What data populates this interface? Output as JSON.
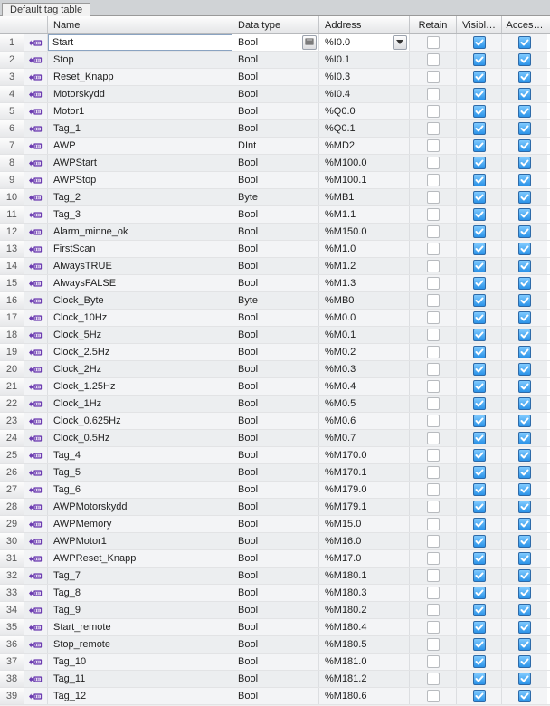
{
  "tab_title": "Default tag table",
  "columns": {
    "name": "Name",
    "dtype": "Data type",
    "addr": "Address",
    "retain": "Retain",
    "visibl": "Visibl…",
    "access": "Acces…"
  },
  "selected_row_index": 0,
  "rows": [
    {
      "num": "1",
      "name": "Start",
      "dtype": "Bool",
      "addr": "%I0.0",
      "retain": false,
      "visibl": true,
      "access": true
    },
    {
      "num": "2",
      "name": "Stop",
      "dtype": "Bool",
      "addr": "%I0.1",
      "retain": false,
      "visibl": true,
      "access": true
    },
    {
      "num": "3",
      "name": "Reset_Knapp",
      "dtype": "Bool",
      "addr": "%I0.3",
      "retain": false,
      "visibl": true,
      "access": true
    },
    {
      "num": "4",
      "name": "Motorskydd",
      "dtype": "Bool",
      "addr": "%I0.4",
      "retain": false,
      "visibl": true,
      "access": true
    },
    {
      "num": "5",
      "name": "Motor1",
      "dtype": "Bool",
      "addr": "%Q0.0",
      "retain": false,
      "visibl": true,
      "access": true
    },
    {
      "num": "6",
      "name": "Tag_1",
      "dtype": "Bool",
      "addr": "%Q0.1",
      "retain": false,
      "visibl": true,
      "access": true
    },
    {
      "num": "7",
      "name": "AWP",
      "dtype": "DInt",
      "addr": "%MD2",
      "retain": false,
      "visibl": true,
      "access": true
    },
    {
      "num": "8",
      "name": "AWPStart",
      "dtype": "Bool",
      "addr": "%M100.0",
      "retain": false,
      "visibl": true,
      "access": true
    },
    {
      "num": "9",
      "name": "AWPStop",
      "dtype": "Bool",
      "addr": "%M100.1",
      "retain": false,
      "visibl": true,
      "access": true
    },
    {
      "num": "10",
      "name": "Tag_2",
      "dtype": "Byte",
      "addr": "%MB1",
      "retain": false,
      "visibl": true,
      "access": true
    },
    {
      "num": "11",
      "name": "Tag_3",
      "dtype": "Bool",
      "addr": "%M1.1",
      "retain": false,
      "visibl": true,
      "access": true
    },
    {
      "num": "12",
      "name": "Alarm_minne_ok",
      "dtype": "Bool",
      "addr": "%M150.0",
      "retain": false,
      "visibl": true,
      "access": true
    },
    {
      "num": "13",
      "name": "FirstScan",
      "dtype": "Bool",
      "addr": "%M1.0",
      "retain": false,
      "visibl": true,
      "access": true
    },
    {
      "num": "14",
      "name": "AlwaysTRUE",
      "dtype": "Bool",
      "addr": "%M1.2",
      "retain": false,
      "visibl": true,
      "access": true
    },
    {
      "num": "15",
      "name": "AlwaysFALSE",
      "dtype": "Bool",
      "addr": "%M1.3",
      "retain": false,
      "visibl": true,
      "access": true
    },
    {
      "num": "16",
      "name": "Clock_Byte",
      "dtype": "Byte",
      "addr": "%MB0",
      "retain": false,
      "visibl": true,
      "access": true
    },
    {
      "num": "17",
      "name": "Clock_10Hz",
      "dtype": "Bool",
      "addr": "%M0.0",
      "retain": false,
      "visibl": true,
      "access": true
    },
    {
      "num": "18",
      "name": "Clock_5Hz",
      "dtype": "Bool",
      "addr": "%M0.1",
      "retain": false,
      "visibl": true,
      "access": true
    },
    {
      "num": "19",
      "name": "Clock_2.5Hz",
      "dtype": "Bool",
      "addr": "%M0.2",
      "retain": false,
      "visibl": true,
      "access": true
    },
    {
      "num": "20",
      "name": "Clock_2Hz",
      "dtype": "Bool",
      "addr": "%M0.3",
      "retain": false,
      "visibl": true,
      "access": true
    },
    {
      "num": "21",
      "name": "Clock_1.25Hz",
      "dtype": "Bool",
      "addr": "%M0.4",
      "retain": false,
      "visibl": true,
      "access": true
    },
    {
      "num": "22",
      "name": "Clock_1Hz",
      "dtype": "Bool",
      "addr": "%M0.5",
      "retain": false,
      "visibl": true,
      "access": true
    },
    {
      "num": "23",
      "name": "Clock_0.625Hz",
      "dtype": "Bool",
      "addr": "%M0.6",
      "retain": false,
      "visibl": true,
      "access": true
    },
    {
      "num": "24",
      "name": "Clock_0.5Hz",
      "dtype": "Bool",
      "addr": "%M0.7",
      "retain": false,
      "visibl": true,
      "access": true
    },
    {
      "num": "25",
      "name": "Tag_4",
      "dtype": "Bool",
      "addr": "%M170.0",
      "retain": false,
      "visibl": true,
      "access": true
    },
    {
      "num": "26",
      "name": "Tag_5",
      "dtype": "Bool",
      "addr": "%M170.1",
      "retain": false,
      "visibl": true,
      "access": true
    },
    {
      "num": "27",
      "name": "Tag_6",
      "dtype": "Bool",
      "addr": "%M179.0",
      "retain": false,
      "visibl": true,
      "access": true
    },
    {
      "num": "28",
      "name": "AWPMotorskydd",
      "dtype": "Bool",
      "addr": "%M179.1",
      "retain": false,
      "visibl": true,
      "access": true
    },
    {
      "num": "29",
      "name": "AWPMemory",
      "dtype": "Bool",
      "addr": "%M15.0",
      "retain": false,
      "visibl": true,
      "access": true
    },
    {
      "num": "30",
      "name": "AWPMotor1",
      "dtype": "Bool",
      "addr": "%M16.0",
      "retain": false,
      "visibl": true,
      "access": true
    },
    {
      "num": "31",
      "name": "AWPReset_Knapp",
      "dtype": "Bool",
      "addr": "%M17.0",
      "retain": false,
      "visibl": true,
      "access": true
    },
    {
      "num": "32",
      "name": "Tag_7",
      "dtype": "Bool",
      "addr": "%M180.1",
      "retain": false,
      "visibl": true,
      "access": true
    },
    {
      "num": "33",
      "name": "Tag_8",
      "dtype": "Bool",
      "addr": "%M180.3",
      "retain": false,
      "visibl": true,
      "access": true
    },
    {
      "num": "34",
      "name": "Tag_9",
      "dtype": "Bool",
      "addr": "%M180.2",
      "retain": false,
      "visibl": true,
      "access": true
    },
    {
      "num": "35",
      "name": "Start_remote",
      "dtype": "Bool",
      "addr": "%M180.4",
      "retain": false,
      "visibl": true,
      "access": true
    },
    {
      "num": "36",
      "name": "Stop_remote",
      "dtype": "Bool",
      "addr": "%M180.5",
      "retain": false,
      "visibl": true,
      "access": true
    },
    {
      "num": "37",
      "name": "Tag_10",
      "dtype": "Bool",
      "addr": "%M181.0",
      "retain": false,
      "visibl": true,
      "access": true
    },
    {
      "num": "38",
      "name": "Tag_11",
      "dtype": "Bool",
      "addr": "%M181.2",
      "retain": false,
      "visibl": true,
      "access": true
    },
    {
      "num": "39",
      "name": "Tag_12",
      "dtype": "Bool",
      "addr": "%M180.6",
      "retain": false,
      "visibl": true,
      "access": true
    }
  ]
}
